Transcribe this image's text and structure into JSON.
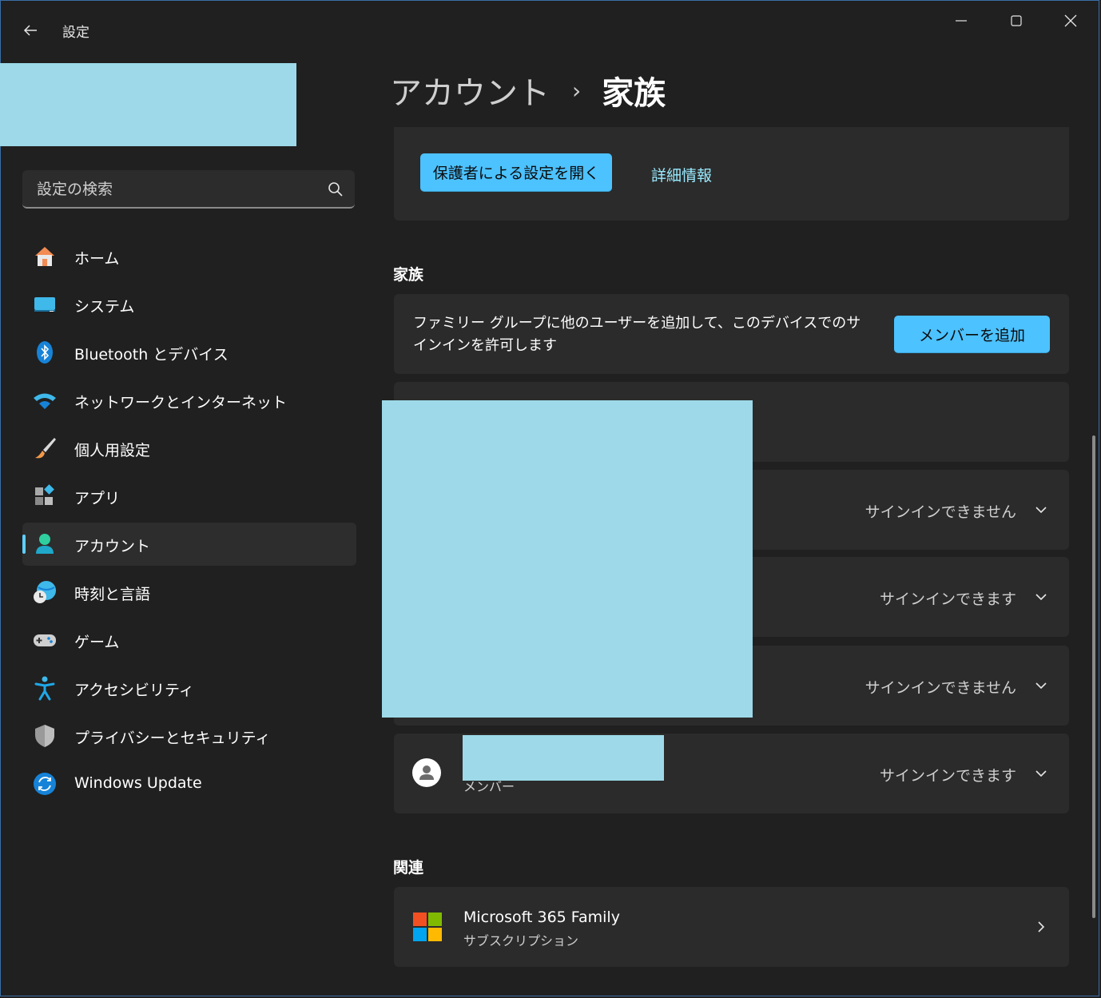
{
  "window": {
    "title": "設定",
    "controls": [
      "minimize-icon",
      "maximize-icon",
      "close-icon"
    ]
  },
  "search": {
    "placeholder": "設定の検索",
    "icon": "search-icon"
  },
  "sidebar": {
    "items": [
      {
        "label": "ホーム",
        "icon": "home-icon"
      },
      {
        "label": "システム",
        "icon": "system-icon"
      },
      {
        "label": "Bluetooth とデバイス",
        "icon": "bluetooth-icon"
      },
      {
        "label": "ネットワークとインターネット",
        "icon": "wifi-icon"
      },
      {
        "label": "個人用設定",
        "icon": "brush-icon"
      },
      {
        "label": "アプリ",
        "icon": "apps-icon"
      },
      {
        "label": "アカウント",
        "icon": "account-icon",
        "selected": true
      },
      {
        "label": "時刻と言語",
        "icon": "globe-clock-icon"
      },
      {
        "label": "ゲーム",
        "icon": "gamepad-icon"
      },
      {
        "label": "アクセシビリティ",
        "icon": "accessibility-icon"
      },
      {
        "label": "プライバシーとセキュリティ",
        "icon": "shield-icon"
      },
      {
        "label": "Windows Update",
        "icon": "update-icon"
      }
    ]
  },
  "breadcrumb": {
    "parent": "アカウント",
    "separator": "›",
    "current": "家族"
  },
  "parental": {
    "open_button": "保護者による設定を開く",
    "more_info_link": "詳細情報"
  },
  "family": {
    "section_title": "家族",
    "add_text": "ファミリー グループに他のユーザーを追加して、このデバイスでのサインインを許可します",
    "add_button": "メンバーを追加",
    "members": [
      {
        "status": "サインインできません"
      },
      {
        "status": "サインインできます"
      },
      {
        "status": "サインインできません"
      },
      {
        "role": "メンバー",
        "status": "サインインできます"
      }
    ]
  },
  "related": {
    "section_title": "関連",
    "item_title": "Microsoft 365 Family",
    "item_subtitle": "サブスクリプション"
  },
  "colors": {
    "accent": "#4cc2ff",
    "link": "#99ebff",
    "background": "#202020",
    "card": "#2b2b2b",
    "redaction": "#9dd9e8"
  }
}
